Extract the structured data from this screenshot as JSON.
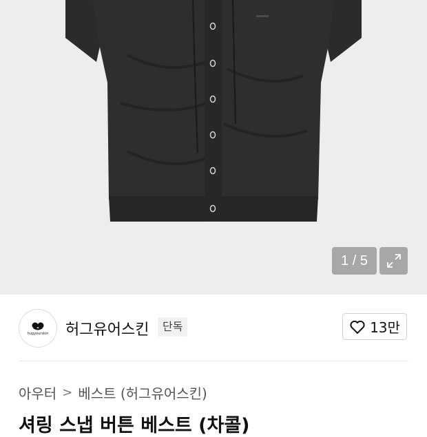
{
  "gallery": {
    "counter": "1 / 5",
    "expand_icon": "expand-icon",
    "image_alt": "black shirring snap button vest"
  },
  "brand": {
    "name": "허그유어스킨",
    "badge": "단독",
    "logo_text": "hugyourskin",
    "like_icon": "heart-icon",
    "like_count": "13만"
  },
  "breadcrumb": {
    "items": [
      "아우터",
      "베스트 (허그유어스킨)"
    ],
    "separator": ">"
  },
  "product": {
    "title": "셔링 스냅 버튼 베스트 (차콜)"
  },
  "colors": {
    "garment": "#2a2a2a",
    "gallery_bg": "#ededed"
  }
}
